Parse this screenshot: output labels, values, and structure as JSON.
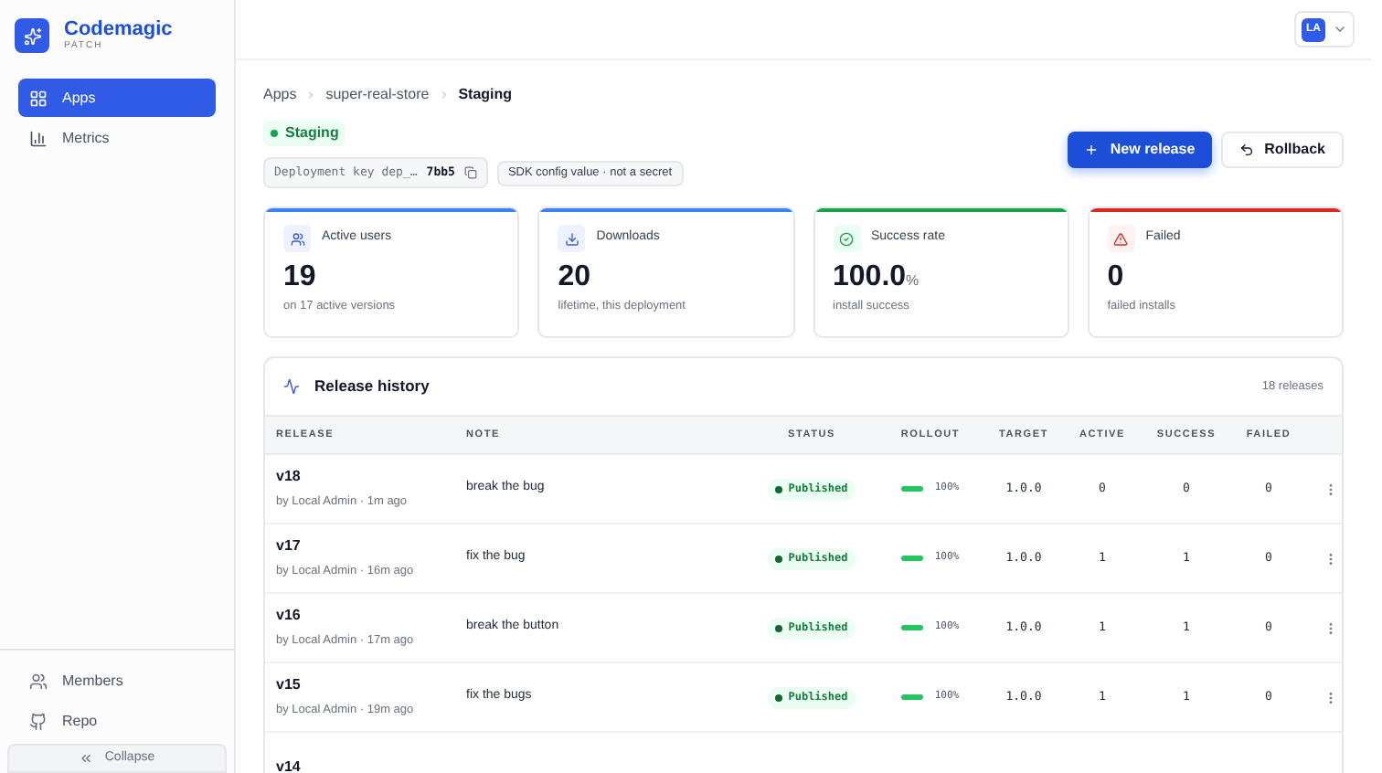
{
  "brand": {
    "name": "Codemagic",
    "sub": "PATCH"
  },
  "sidebar": {
    "items": [
      {
        "label": "Apps",
        "selected": true
      },
      {
        "label": "Metrics",
        "selected": false
      }
    ],
    "bottom_items": [
      {
        "label": "Members"
      },
      {
        "label": "Repo"
      }
    ],
    "collapse": "Collapse"
  },
  "header": {
    "avatar": "LA"
  },
  "breadcrumb": [
    "Apps",
    "super-real-store",
    "Staging"
  ],
  "environment": {
    "label": "Staging",
    "color": "#16a34a"
  },
  "deployment_key": {
    "label": "Deployment key dep_…",
    "value": "7bb5"
  },
  "sdk_note": "SDK config value · not a secret",
  "actions": [
    {
      "label": "New release",
      "kind": "primary"
    },
    {
      "label": "Rollback",
      "kind": "secondary"
    }
  ],
  "stats": [
    {
      "title": "Active users",
      "color": "#3b82f6",
      "value": "19",
      "caption": "on 17 active versions"
    },
    {
      "title": "Downloads",
      "color": "#3b82f6",
      "value": "20",
      "caption": "lifetime, this deployment"
    },
    {
      "title": "Success rate",
      "color": "#16a34a",
      "value": "100.0",
      "unit": "%",
      "caption": "install success"
    },
    {
      "title": "Failed",
      "color": "#dc2626",
      "value": "0",
      "caption": "failed installs"
    }
  ],
  "release_history": {
    "title": "Release history",
    "count": "18 releases",
    "columns": [
      "RELEASE",
      "NOTE",
      "STATUS",
      "ROLLOUT",
      "TARGET",
      "ACTIVE",
      "SUCCESS",
      "FAILED"
    ],
    "rows": [
      {
        "version": "v18",
        "meta": "by Local Admin · 1m ago",
        "note": "break the bug",
        "status": "Published",
        "level": 1,
        "rollout": "100%",
        "target": "1.0.0",
        "active": "0",
        "success": "0",
        "failed": "0"
      },
      {
        "version": "v17",
        "meta": "by Local Admin · 16m ago",
        "note": "fix the bug",
        "status": "Published",
        "level": 1,
        "rollout": "100%",
        "target": "1.0.0",
        "active": "1",
        "success": "1",
        "failed": "0"
      },
      {
        "version": "v16",
        "meta": "by Local Admin · 17m ago",
        "note": "break the button",
        "status": "Published",
        "level": 1,
        "rollout": "100%",
        "target": "1.0.0",
        "active": "1",
        "success": "1",
        "failed": "0"
      },
      {
        "version": "v15",
        "meta": "by Local Admin · 19m ago",
        "note": "fix the bugs",
        "status": "Published",
        "level": 1,
        "rollout": "100%",
        "target": "1.0.0",
        "active": "1",
        "success": "1",
        "failed": "0"
      },
      {
        "version": "v14"
      }
    ]
  }
}
